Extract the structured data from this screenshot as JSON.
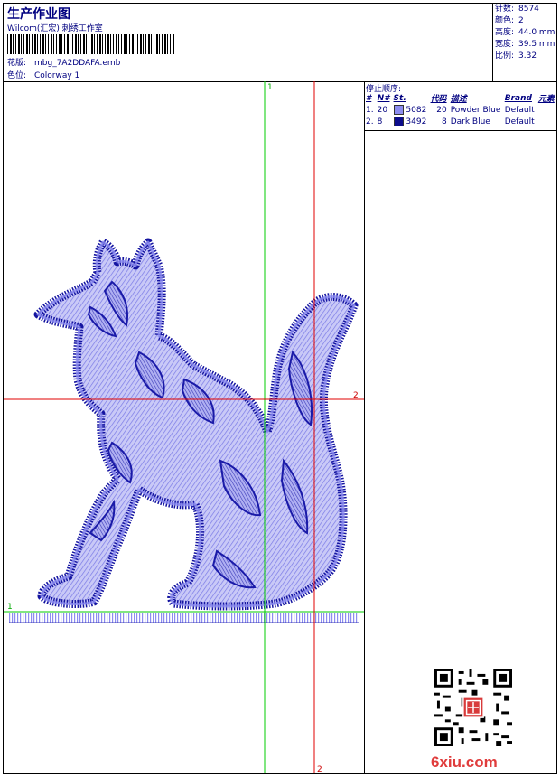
{
  "header": {
    "title": "生产作业图",
    "company": "Wilcom(汇宏) 刺绣工作室",
    "pattern_label": "花版:",
    "pattern_value": "mbg_7A2DDAFA.emb",
    "colorway_label": "色位:",
    "colorway_value": "Colorway 1"
  },
  "stats": [
    {
      "label": "针数:",
      "value": "8574"
    },
    {
      "label": "颜色:",
      "value": "2"
    },
    {
      "label": "高度:",
      "value": "44.0 mm"
    },
    {
      "label": "宽度:",
      "value": "39.5 mm"
    },
    {
      "label": "比例:",
      "value": "3.32"
    }
  ],
  "sequence": {
    "title": "停止顺序:",
    "columns": [
      "#",
      "N#",
      "St.",
      "代码",
      "描述",
      "Brand",
      "元素"
    ],
    "rows": [
      {
        "num": "1.",
        "needle": "20",
        "color": "#8c8cf0",
        "stitches": "5082",
        "code": "20",
        "desc": "Powder Blue",
        "brand": "Default"
      },
      {
        "num": "2.",
        "needle": "8",
        "color": "#0c0c8c",
        "stitches": "3492",
        "code": "8",
        "desc": "Dark Blue",
        "brand": "Default"
      }
    ]
  },
  "guides": {
    "h_green_label": "1",
    "v_green_label": "1",
    "h_red_label": "2",
    "v_red_label": "2"
  },
  "colors": {
    "text": "#000080",
    "guide_green": "#00cc00",
    "guide_red": "#e00000",
    "thread_light": "#8c8cf0",
    "thread_dark": "#0c0c8c"
  },
  "watermark": "6xiu.com"
}
